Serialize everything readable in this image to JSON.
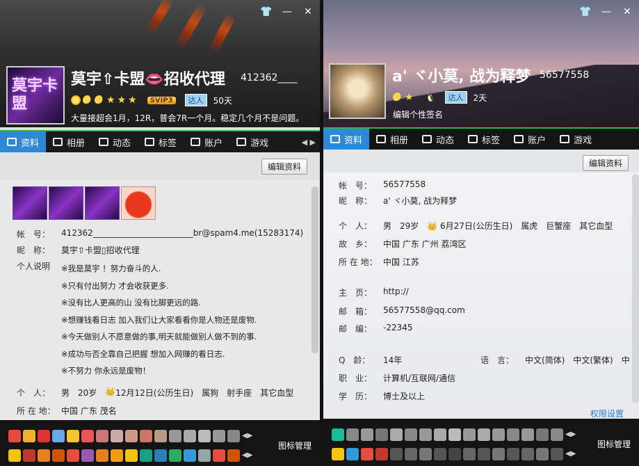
{
  "left": {
    "nickname": "莫宇⇧卡盟👄招收代理",
    "qq": "412362____",
    "avatar_text": "莫宇卡盟",
    "level_icons": [
      "sun",
      "moon",
      "moon",
      "star",
      "star",
      "star"
    ],
    "vip": "SVIP3",
    "daren": "达人",
    "days": "50天",
    "signature": "大量接超会1月，12R，普会7R一个月。稳定几个月不是问题。",
    "tabs": [
      "资料",
      "相册",
      "动态",
      "标签",
      "账户",
      "游戏"
    ],
    "edit": "编辑资料",
    "account_label": "帐　号：",
    "account_value": "412362________________________br@spam4.me(15283174)",
    "nick_label": "昵　称：",
    "nick_value": "莫宇⇧卡盟▯招收代理",
    "desc_label": "个人说明",
    "desc": [
      "※我是莫宇 ！努力奋斗的人.",
      "※只有付出努力 才会收获更多.",
      "※没有比人更高的山 没有比脚更远的路.",
      "※想赚钱看日志 加入我们让大家看看你是人物还是废物.",
      "※今天做别人不愿意做的事,明天就能做别人做不到的事.",
      "※成功与否全靠自己把握 想加入网赚的看日志.",
      "※不努力 你永远是废物！"
    ],
    "person_label": "个　人：",
    "person": [
      "男",
      "20岁",
      "12月12日(公历生日)",
      "属狗",
      "射手座",
      "其它血型"
    ],
    "loc_label": "所 在 地：",
    "loc": "中国 广东 茂名",
    "manage": "图标管理"
  },
  "right": {
    "nickname": "a' ヾ小莫, 战为释梦",
    "qq": "56577558",
    "days": "2天",
    "daren": "达人",
    "signature": "编辑个性签名",
    "tabs": [
      "资料",
      "相册",
      "动态",
      "标签",
      "账户",
      "游戏"
    ],
    "edit": "编辑资料",
    "fields": [
      {
        "label": "帐　号：",
        "value": "56577558"
      },
      {
        "label": "昵　称：",
        "value": "a' ヾ小莫, 战为释梦"
      },
      {
        "label": "个　人：",
        "value": "男　29岁　👑 6月27日(公历生日)　属虎　巨蟹座　其它血型"
      },
      {
        "label": "故　乡：",
        "value": "中国 广东 广州 荔湾区"
      },
      {
        "label": "所 在 地：",
        "value": "中国 江苏"
      },
      {
        "label": "主　页：",
        "value": "http://"
      },
      {
        "label": "邮　箱：",
        "value": "56577558@qq.com"
      },
      {
        "label": "邮　编：",
        "value": "-22345"
      },
      {
        "label": "Q　龄：",
        "value": "14年"
      },
      {
        "label": "职　业：",
        "value": "计算机/互联网/通信"
      },
      {
        "label": "学　历：",
        "value": "博士及以上"
      }
    ],
    "lang_label": "语　言：",
    "lang": "中文(简体)　中文(繁体)　中",
    "perm": "权限设置",
    "manage": "图标管理"
  }
}
